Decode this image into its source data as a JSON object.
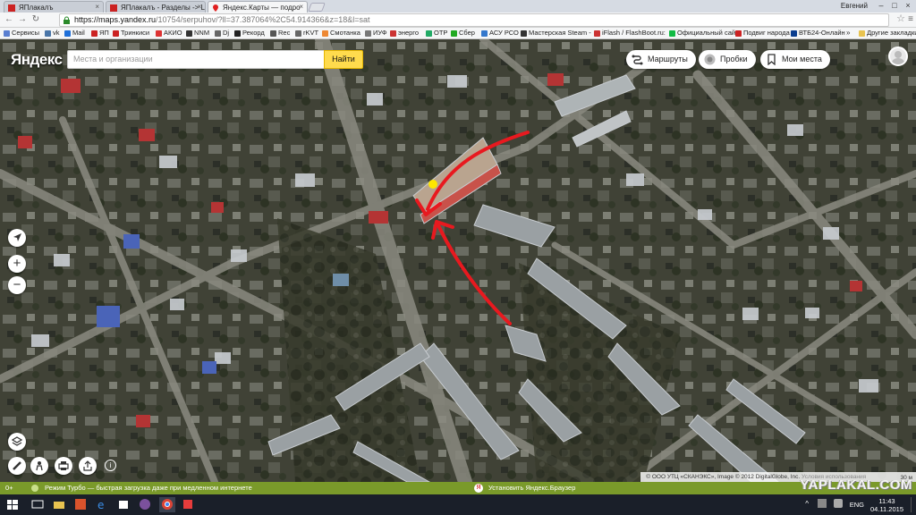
{
  "browser": {
    "tabs": [
      {
        "title": "ЯПлакалъ",
        "active": false
      },
      {
        "title": "ЯПлакалъ - Разделы -> L",
        "active": false
      },
      {
        "title": "Яндекс.Карты — подро",
        "active": true
      }
    ],
    "user_name": "Евгений",
    "url_host": "https://maps.yandex.ru",
    "url_rest": "/10754/serpuhov/?ll=37.387064%2C54.914366&z=18&l=sat",
    "bookmarks": [
      "Сервисы",
      "vk",
      "Mail",
      "ЯП",
      "Тринкиси",
      "АКИО",
      "NNM",
      "Dj",
      "Рекорд",
      "Rec",
      "rKVT",
      "Смотанка",
      "ИУФ",
      "энерго",
      "ОТР",
      "Сбер",
      "АСУ РСО",
      "Мастерская Steam -",
      "iFlash / FlashBoot.ru:",
      "Официальный сайт",
      "Подвиг народа",
      "ВТБ24-Онлайн"
    ],
    "bookmarks_more": "»",
    "other_bookmarks": "Другие закладки"
  },
  "map": {
    "logo": "Яндекс",
    "search_placeholder": "Места и организации",
    "search_button": "Найти",
    "routes_label": "Маршруты",
    "traffic_label": "Пробки",
    "my_places_label": "Мои места",
    "zoom_in": "+",
    "zoom_out": "−",
    "copyright": "© ООО УТЦ «СКАНЭКС», Image © 2012 DigitalGlobe, Inc.",
    "terms": "Условия использования",
    "scale": "30 м"
  },
  "turbo_bar": {
    "left_indicator": "0+",
    "message": "Режим Турбо — быстрая загрузка даже при медленном интернете",
    "install_text": "Установить Яндекс.Браузер"
  },
  "watermark": "YAPLAKAL.COM",
  "taskbar": {
    "language": "ENG",
    "time": "11:43",
    "date": "04.11.2015"
  },
  "colors": {
    "search_button": "#ffdb4d",
    "annotation_arrow": "#e8191f",
    "marker": "#ffe600",
    "turbo_bar": "#7a9a2a"
  }
}
